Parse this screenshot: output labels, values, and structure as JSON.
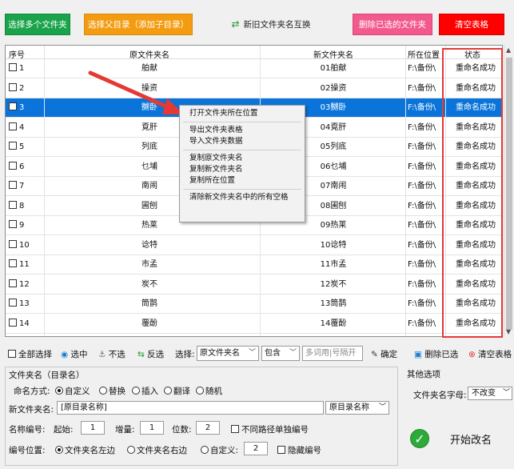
{
  "toolbar_top": {
    "select_folders": "选择多个文件夹",
    "select_parent": "选择父目录（添加子目录）",
    "swap_names": "新旧文件夹名互换",
    "delete_selected": "删除已选的文件夹",
    "clear_table": "清空表格"
  },
  "grid": {
    "headers": {
      "no": "序号",
      "old": "原文件夹名",
      "new": "新文件夹名",
      "loc": "所在位置",
      "status": "状态"
    },
    "rows": [
      {
        "no": "1",
        "old": "舶献",
        "new": "01舶献",
        "loc": "F:\\备份\\",
        "status": "重命名成功"
      },
      {
        "no": "2",
        "old": "操资",
        "new": "02操资",
        "loc": "F:\\备份\\",
        "status": "重命名成功"
      },
      {
        "no": "3",
        "old": "嬲卧",
        "new": "03嬲卧",
        "loc": "F:\\备份\\",
        "status": "重命名成功"
      },
      {
        "no": "4",
        "old": "覔肝",
        "new": "04覔肝",
        "loc": "F:\\备份\\",
        "status": "重命名成功"
      },
      {
        "no": "5",
        "old": "列底",
        "new": "05列底",
        "loc": "F:\\备份\\",
        "status": "重命名成功"
      },
      {
        "no": "6",
        "old": "乜埔",
        "new": "06乜埔",
        "loc": "F:\\备份\\",
        "status": "重命名成功"
      },
      {
        "no": "7",
        "old": "南闹",
        "new": "07南闹",
        "loc": "F:\\备份\\",
        "status": "重命名成功"
      },
      {
        "no": "8",
        "old": "圃刨",
        "new": "08圃刨",
        "loc": "F:\\备份\\",
        "status": "重命名成功"
      },
      {
        "no": "9",
        "old": "热莱",
        "new": "09热莱",
        "loc": "F:\\备份\\",
        "status": "重命名成功"
      },
      {
        "no": "10",
        "old": "谂特",
        "new": "10谂特",
        "loc": "F:\\备份\\",
        "status": "重命名成功"
      },
      {
        "no": "11",
        "old": "市孟",
        "new": "11市孟",
        "loc": "F:\\备份\\",
        "status": "重命名成功"
      },
      {
        "no": "12",
        "old": "炭不",
        "new": "12炭不",
        "loc": "F:\\备份\\",
        "status": "重命名成功"
      },
      {
        "no": "13",
        "old": "筒鹊",
        "new": "13筒鹊",
        "loc": "F:\\备份\\",
        "status": "重命名成功"
      },
      {
        "no": "14",
        "old": "覆酚",
        "new": "14覆酚",
        "loc": "F:\\备份\\",
        "status": "重命名成功"
      }
    ]
  },
  "context_menu": {
    "open_location": "打开文件夹所在位置",
    "export_table": "导出文件夹表格",
    "import_data": "导入文件夹数据",
    "copy_old": "复制原文件夹名",
    "copy_new": "复制新文件夹名",
    "copy_loc": "复制所在位置",
    "clear_spaces": "清除新文件夹名中的所有空格"
  },
  "toolbar_mid": {
    "select_all": "全部选择",
    "select": "选中",
    "unselect": "不选",
    "invert": "反选",
    "choose_label": "选择:",
    "field_value": "原文件夹名",
    "match_value": "包含",
    "keyword_placeholder": "多词用|号隔开",
    "confirm": "确定",
    "delete_selected": "删除已选",
    "clear_table": "清空表格"
  },
  "options": {
    "group_title": "文件夹名（目录名）",
    "mode_label": "命名方式:",
    "modes": [
      "自定义",
      "替换",
      "插入",
      "翻译",
      "随机"
    ],
    "new_name_label": "新文件夹名:",
    "new_name_value": "[原目录名称]",
    "insert_value": "原目录名称",
    "numbering_label": "名称编号:",
    "start_label": "起始:",
    "start_value": "1",
    "step_label": "增量:",
    "step_value": "1",
    "digits_label": "位数:",
    "digits_value": "2",
    "separate_label": "不同路径单独编号",
    "position_label": "编号位置:",
    "pos_left": "文件夹名左边",
    "pos_right": "文件夹名右边",
    "pos_custom": "自定义:",
    "pos_custom_value": "2",
    "hide_number": "隐藏编号"
  },
  "other": {
    "title": "其他选项",
    "case_label": "文件夹名字母:",
    "case_value": "不改变",
    "start_button": "开始改名"
  }
}
